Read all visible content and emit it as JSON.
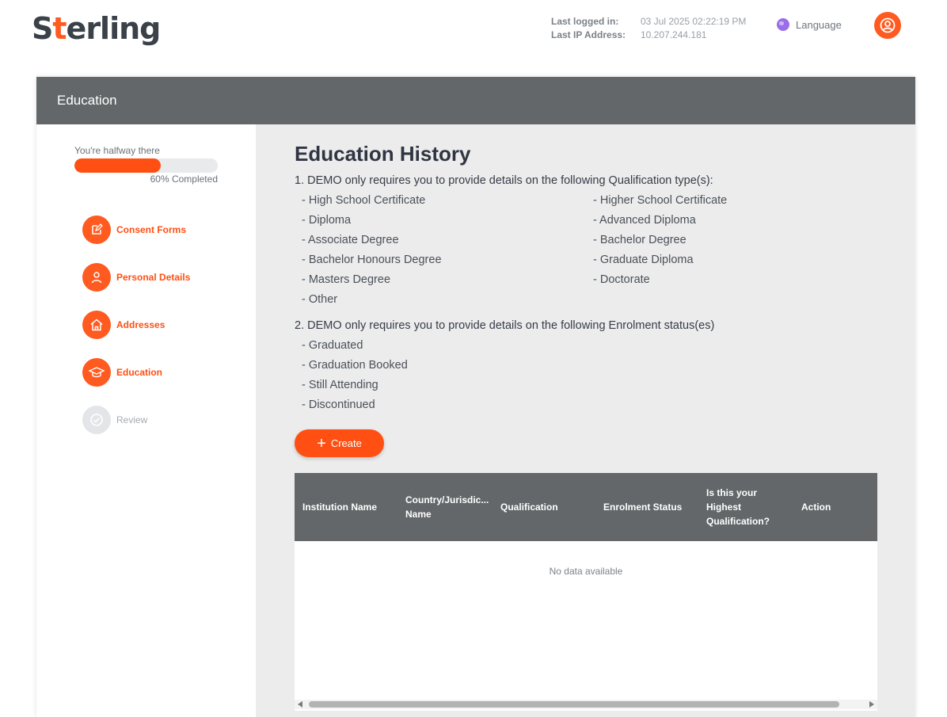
{
  "header": {
    "logo": {
      "pre": "S",
      "accent": "t",
      "post": "erling"
    },
    "last_logged_in_label": "Last logged in:",
    "last_logged_in_value": "03 Jul 2025 02:22:19 PM",
    "last_ip_label": "Last IP Address:",
    "last_ip_value": "10.207.244.181",
    "language_label": "Language"
  },
  "card": {
    "title": "Education"
  },
  "sidebar": {
    "progress_caption": "You're halfway there",
    "progress_percent": 60,
    "progress_label": "60% Completed",
    "steps": [
      {
        "label": "Consent Forms",
        "icon": "edit-icon",
        "state": "done"
      },
      {
        "label": "Personal Details",
        "icon": "person-icon",
        "state": "done"
      },
      {
        "label": "Addresses",
        "icon": "home-icon",
        "state": "done"
      },
      {
        "label": "Education",
        "icon": "graduation-cap-icon",
        "state": "active"
      },
      {
        "label": "Review",
        "icon": "check-circle-icon",
        "state": "disabled"
      }
    ]
  },
  "main": {
    "title": "Education History",
    "qualification_intro": "1. DEMO only requires you to provide details on the following Qualification type(s):",
    "qualifications_left": [
      "- High School Certificate",
      "- Diploma",
      "- Associate Degree",
      "- Bachelor Honours Degree",
      "- Masters Degree",
      "- Other"
    ],
    "qualifications_right": [
      "- Higher School Certificate",
      "- Advanced Diploma",
      "- Bachelor Degree",
      "- Graduate Diploma",
      "- Doctorate"
    ],
    "enrolment_intro": "2. DEMO only requires you to provide details on the following Enrolment status(es)",
    "enrolment_statuses": [
      "- Graduated",
      "- Graduation Booked",
      "- Still Attending",
      "- Discontinued"
    ],
    "create_label": "Create",
    "table": {
      "columns": [
        "Institution Name",
        "Country/Jurisdic... Name",
        "Qualification",
        "Enrolment Status",
        "Is this your Highest Qualification?",
        "Action"
      ],
      "empty_text": "No data available"
    }
  },
  "colors": {
    "accent": "#ff4f12",
    "header_bar": "#636769",
    "content_bg": "#ececec"
  }
}
